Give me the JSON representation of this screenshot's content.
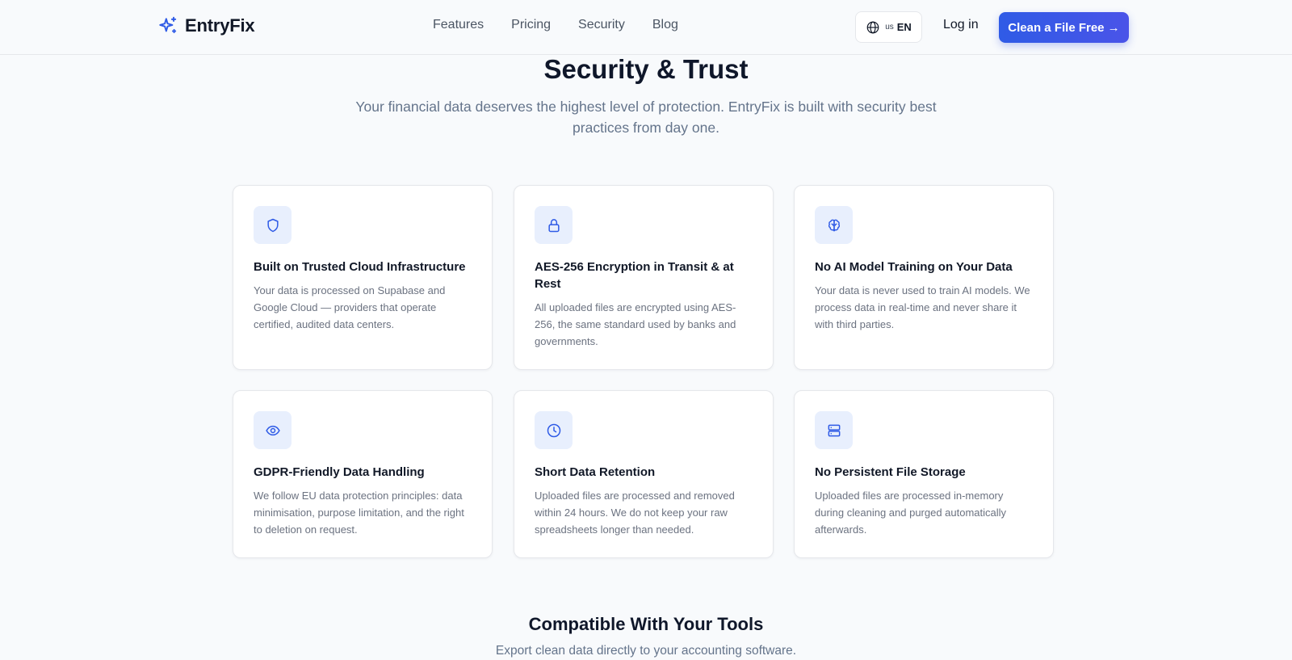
{
  "header": {
    "brand": "EntryFix",
    "nav": [
      "Features",
      "Pricing",
      "Security",
      "Blog"
    ],
    "lang_flag": "us",
    "lang_code": "EN",
    "login_label": "Log in",
    "cta_label": "Clean a File Free →"
  },
  "hero": {
    "title": "Security & Trust",
    "subtitle": "Your financial data deserves the highest level of protection. EntryFix is built with security best practices from day one."
  },
  "cards": [
    {
      "icon": "shield-icon",
      "title": "Built on Trusted Cloud Infrastructure",
      "description": "Your data is processed on Supabase and Google Cloud — providers that operate certified, audited data centers."
    },
    {
      "icon": "lock-icon",
      "title": "AES-256 Encryption in Transit & at Rest",
      "description": "All uploaded files are encrypted using AES-256, the same standard used by banks and governments."
    },
    {
      "icon": "brain-icon",
      "title": "No AI Model Training on Your Data",
      "description": "Your data is never used to train AI models. We process data in real-time and never share it with third parties."
    },
    {
      "icon": "eye-icon",
      "title": "GDPR-Friendly Data Handling",
      "description": "We follow EU data protection principles: data minimisation, purpose limitation, and the right to deletion on request."
    },
    {
      "icon": "clock-icon",
      "title": "Short Data Retention",
      "description": "Uploaded files are processed and removed within 24 hours. We do not keep your raw spreadsheets longer than needed."
    },
    {
      "icon": "server-icon",
      "title": "No Persistent File Storage",
      "description": "Uploaded files are processed in-memory during cleaning and purged automatically afterwards."
    }
  ],
  "compatible": {
    "title": "Compatible With Your Tools",
    "subtitle": "Export clean data directly to your accounting software."
  },
  "colors": {
    "accent": "#2f5be6",
    "icon_bg": "#e8effd",
    "background": "#f8fafc"
  }
}
